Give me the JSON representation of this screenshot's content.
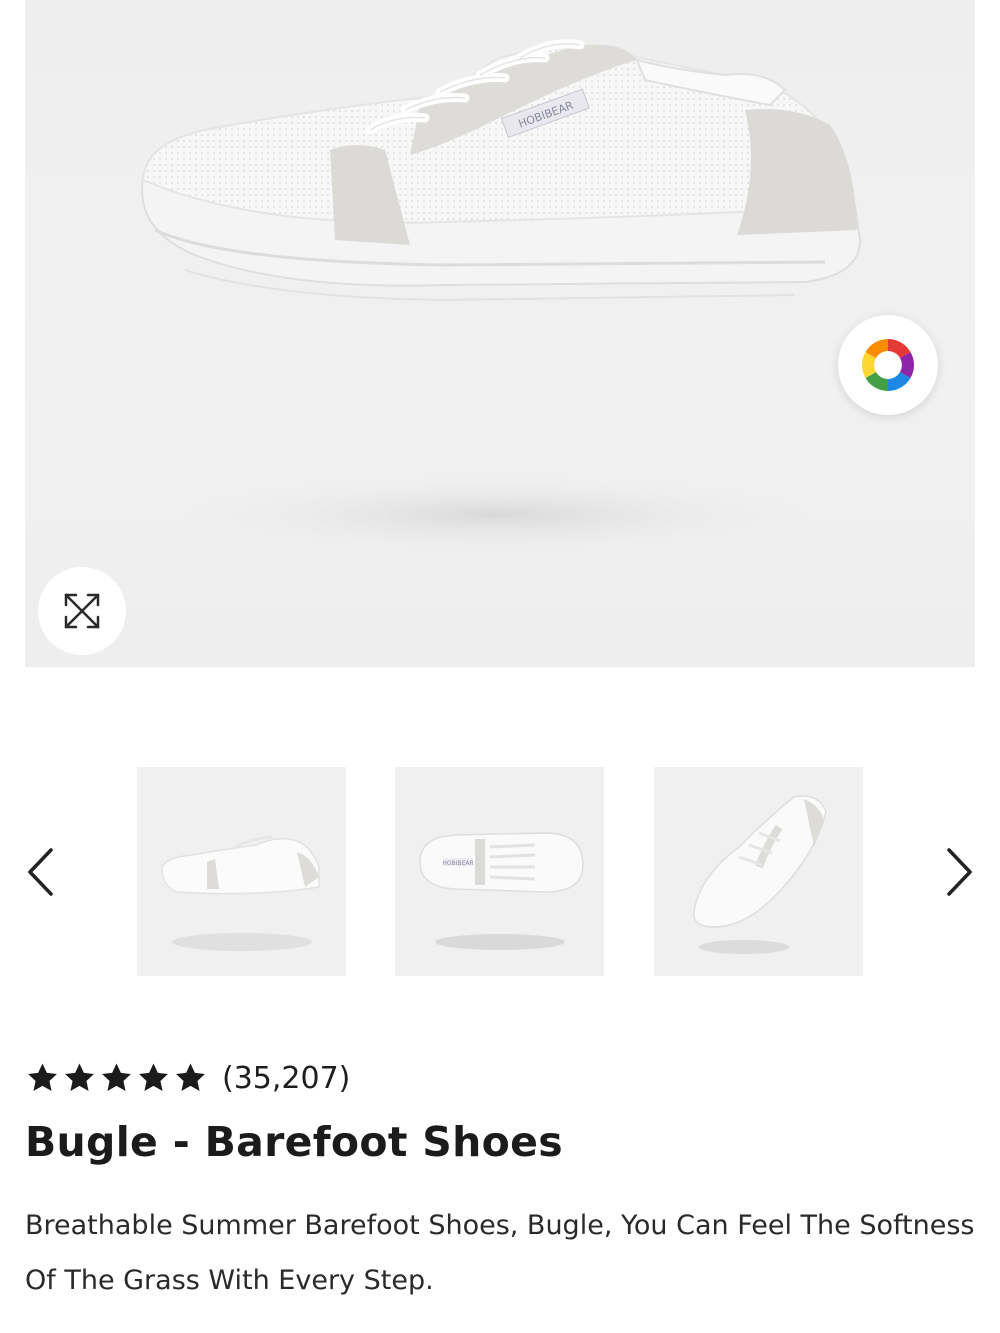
{
  "gallery": {
    "main_image": {
      "icon": "white-sneaker-image",
      "brand_tag": "HOBIBEAR"
    },
    "color_picker_icon": "color-wheel-icon",
    "expand_icon": "expand-arrows-icon",
    "prev_icon": "chevron-left-icon",
    "next_icon": "chevron-right-icon",
    "thumbnails": [
      {
        "icon": "shoe-side-view-thumbnail"
      },
      {
        "icon": "shoe-top-view-thumbnail",
        "brand_tag": "HOBIBEAR"
      },
      {
        "icon": "shoe-angled-view-thumbnail"
      }
    ]
  },
  "product": {
    "rating_stars": 5,
    "review_count": "(35,207)",
    "title": "Bugle - Barefoot Shoes",
    "description": "Breathable Summer Barefoot Shoes, Bugle, You Can Feel The Softness Of The Grass With Every Step."
  },
  "colors": {
    "star": "#1b1b1b",
    "text": "#1b1b1b",
    "background": "#ffffff"
  }
}
